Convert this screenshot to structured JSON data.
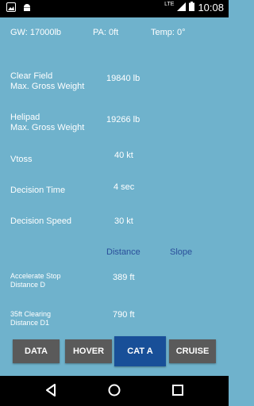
{
  "status": {
    "network": "LTE",
    "time": "10:08"
  },
  "header": {
    "gw": "GW: 17000lb",
    "pa": "PA: 0ft",
    "temp": "Temp: 0°"
  },
  "rows": {
    "clear_field": {
      "label_1": "Clear Field",
      "label_2": "Max. Gross Weight",
      "value": "19840 lb"
    },
    "helipad": {
      "label_1": "Helipad",
      "label_2": "Max. Gross Weight",
      "value": "19266 lb"
    },
    "vtoss": {
      "label": "Vtoss",
      "value": "40 kt"
    },
    "decision_time": {
      "label": "Decision Time",
      "value": "4 sec"
    },
    "decision_speed": {
      "label": "Decision Speed",
      "value": "30 kt"
    }
  },
  "columns": {
    "distance": "Distance",
    "slope": "Slope"
  },
  "distances": {
    "accelerate_stop": {
      "label_1": "Accelerate Stop",
      "label_2": "Distance D",
      "value": "389 ft"
    },
    "clearing_35ft": {
      "label_1": "35ft Clearing",
      "label_2": "Distance D1",
      "value": "790 ft"
    }
  },
  "tabs": [
    {
      "label": "DATA",
      "active": false
    },
    {
      "label": "HOVER",
      "active": false
    },
    {
      "label": "CAT A",
      "active": true
    },
    {
      "label": "CRUISE",
      "active": false
    }
  ],
  "colors": {
    "background": "#6fb2cc",
    "tab": "#5a5a5a",
    "tab_active": "#184f98",
    "link": "#2a4e9a"
  }
}
